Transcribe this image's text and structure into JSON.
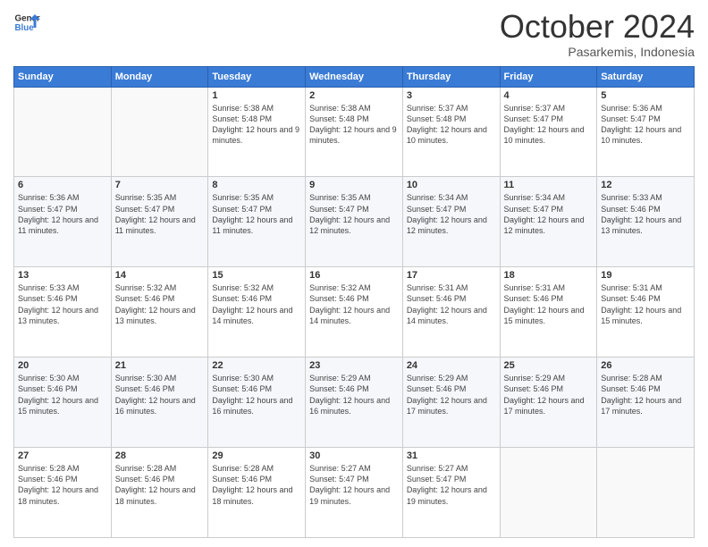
{
  "header": {
    "logo_general": "General",
    "logo_blue": "Blue",
    "month": "October 2024",
    "location": "Pasarkemis, Indonesia"
  },
  "days_of_week": [
    "Sunday",
    "Monday",
    "Tuesday",
    "Wednesday",
    "Thursday",
    "Friday",
    "Saturday"
  ],
  "weeks": [
    [
      {
        "day": "",
        "info": ""
      },
      {
        "day": "",
        "info": ""
      },
      {
        "day": "1",
        "info": "Sunrise: 5:38 AM\nSunset: 5:48 PM\nDaylight: 12 hours and 9 minutes."
      },
      {
        "day": "2",
        "info": "Sunrise: 5:38 AM\nSunset: 5:48 PM\nDaylight: 12 hours and 9 minutes."
      },
      {
        "day": "3",
        "info": "Sunrise: 5:37 AM\nSunset: 5:48 PM\nDaylight: 12 hours and 10 minutes."
      },
      {
        "day": "4",
        "info": "Sunrise: 5:37 AM\nSunset: 5:47 PM\nDaylight: 12 hours and 10 minutes."
      },
      {
        "day": "5",
        "info": "Sunrise: 5:36 AM\nSunset: 5:47 PM\nDaylight: 12 hours and 10 minutes."
      }
    ],
    [
      {
        "day": "6",
        "info": "Sunrise: 5:36 AM\nSunset: 5:47 PM\nDaylight: 12 hours and 11 minutes."
      },
      {
        "day": "7",
        "info": "Sunrise: 5:35 AM\nSunset: 5:47 PM\nDaylight: 12 hours and 11 minutes."
      },
      {
        "day": "8",
        "info": "Sunrise: 5:35 AM\nSunset: 5:47 PM\nDaylight: 12 hours and 11 minutes."
      },
      {
        "day": "9",
        "info": "Sunrise: 5:35 AM\nSunset: 5:47 PM\nDaylight: 12 hours and 12 minutes."
      },
      {
        "day": "10",
        "info": "Sunrise: 5:34 AM\nSunset: 5:47 PM\nDaylight: 12 hours and 12 minutes."
      },
      {
        "day": "11",
        "info": "Sunrise: 5:34 AM\nSunset: 5:47 PM\nDaylight: 12 hours and 12 minutes."
      },
      {
        "day": "12",
        "info": "Sunrise: 5:33 AM\nSunset: 5:46 PM\nDaylight: 12 hours and 13 minutes."
      }
    ],
    [
      {
        "day": "13",
        "info": "Sunrise: 5:33 AM\nSunset: 5:46 PM\nDaylight: 12 hours and 13 minutes."
      },
      {
        "day": "14",
        "info": "Sunrise: 5:32 AM\nSunset: 5:46 PM\nDaylight: 12 hours and 13 minutes."
      },
      {
        "day": "15",
        "info": "Sunrise: 5:32 AM\nSunset: 5:46 PM\nDaylight: 12 hours and 14 minutes."
      },
      {
        "day": "16",
        "info": "Sunrise: 5:32 AM\nSunset: 5:46 PM\nDaylight: 12 hours and 14 minutes."
      },
      {
        "day": "17",
        "info": "Sunrise: 5:31 AM\nSunset: 5:46 PM\nDaylight: 12 hours and 14 minutes."
      },
      {
        "day": "18",
        "info": "Sunrise: 5:31 AM\nSunset: 5:46 PM\nDaylight: 12 hours and 15 minutes."
      },
      {
        "day": "19",
        "info": "Sunrise: 5:31 AM\nSunset: 5:46 PM\nDaylight: 12 hours and 15 minutes."
      }
    ],
    [
      {
        "day": "20",
        "info": "Sunrise: 5:30 AM\nSunset: 5:46 PM\nDaylight: 12 hours and 15 minutes."
      },
      {
        "day": "21",
        "info": "Sunrise: 5:30 AM\nSunset: 5:46 PM\nDaylight: 12 hours and 16 minutes."
      },
      {
        "day": "22",
        "info": "Sunrise: 5:30 AM\nSunset: 5:46 PM\nDaylight: 12 hours and 16 minutes."
      },
      {
        "day": "23",
        "info": "Sunrise: 5:29 AM\nSunset: 5:46 PM\nDaylight: 12 hours and 16 minutes."
      },
      {
        "day": "24",
        "info": "Sunrise: 5:29 AM\nSunset: 5:46 PM\nDaylight: 12 hours and 17 minutes."
      },
      {
        "day": "25",
        "info": "Sunrise: 5:29 AM\nSunset: 5:46 PM\nDaylight: 12 hours and 17 minutes."
      },
      {
        "day": "26",
        "info": "Sunrise: 5:28 AM\nSunset: 5:46 PM\nDaylight: 12 hours and 17 minutes."
      }
    ],
    [
      {
        "day": "27",
        "info": "Sunrise: 5:28 AM\nSunset: 5:46 PM\nDaylight: 12 hours and 18 minutes."
      },
      {
        "day": "28",
        "info": "Sunrise: 5:28 AM\nSunset: 5:46 PM\nDaylight: 12 hours and 18 minutes."
      },
      {
        "day": "29",
        "info": "Sunrise: 5:28 AM\nSunset: 5:46 PM\nDaylight: 12 hours and 18 minutes."
      },
      {
        "day": "30",
        "info": "Sunrise: 5:27 AM\nSunset: 5:47 PM\nDaylight: 12 hours and 19 minutes."
      },
      {
        "day": "31",
        "info": "Sunrise: 5:27 AM\nSunset: 5:47 PM\nDaylight: 12 hours and 19 minutes."
      },
      {
        "day": "",
        "info": ""
      },
      {
        "day": "",
        "info": ""
      }
    ]
  ]
}
